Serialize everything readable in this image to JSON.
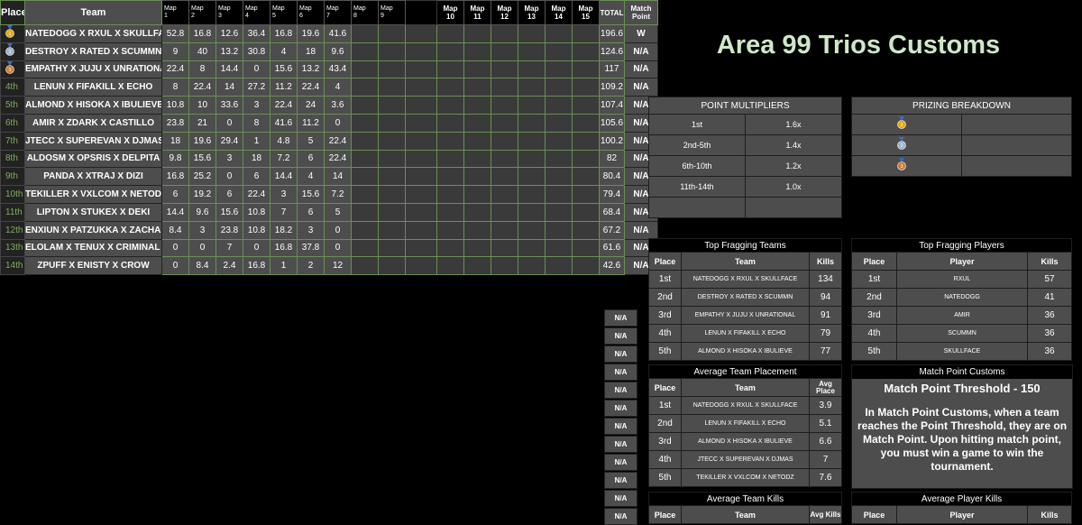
{
  "standings": {
    "headers": {
      "place": "Place",
      "team": "Team",
      "maps_small": [
        "Map 1",
        "Map 2",
        "Map 3",
        "Map 4",
        "Map 5",
        "Map 6",
        "Map 7",
        "Map 8",
        "Map 9"
      ],
      "maps_big": [
        "Map 10",
        "Map 11",
        "Map 12",
        "Map 13",
        "Map 14",
        "Map 15"
      ],
      "total": "TOTAL",
      "match_point": "Match Point"
    },
    "rows": [
      {
        "place": "",
        "medal": "gold",
        "team": "NATEDOGG X RXUL X SKULLFACE",
        "maps": [
          "52.8",
          "16.8",
          "12.6",
          "36.4",
          "16.8",
          "19.6",
          "41.6"
        ],
        "total": "196.6",
        "mp": "W"
      },
      {
        "place": "",
        "medal": "silver",
        "team": "DESTROY X RATED X SCUMMN",
        "maps": [
          "9",
          "40",
          "13.2",
          "30.8",
          "4",
          "18",
          "9.6"
        ],
        "total": "124.6",
        "mp": "N/A"
      },
      {
        "place": "",
        "medal": "bronze",
        "team": "EMPATHY X JUJU X UNRATIONAL",
        "maps": [
          "22.4",
          "8",
          "14.4",
          "0",
          "15.6",
          "13.2",
          "43.4"
        ],
        "total": "117",
        "mp": "N/A"
      },
      {
        "place": "4th",
        "team": "LENUN X FIFAKILL X ECHO",
        "maps": [
          "8",
          "22.4",
          "14",
          "27.2",
          "11.2",
          "22.4",
          "4"
        ],
        "total": "109.2",
        "mp": "N/A"
      },
      {
        "place": "5th",
        "team": "ALMOND X HISOKA X IBULIEVE",
        "maps": [
          "10.8",
          "10",
          "33.6",
          "3",
          "22.4",
          "24",
          "3.6"
        ],
        "total": "107.4",
        "mp": "N/A"
      },
      {
        "place": "6th",
        "team": "AMIR X ZDARK X CASTILLO",
        "maps": [
          "23.8",
          "21",
          "0",
          "8",
          "41.6",
          "11.2",
          "0"
        ],
        "total": "105.6",
        "mp": "N/A"
      },
      {
        "place": "7th",
        "team": "JTECC X SUPEREVAN X DJMAS",
        "maps": [
          "18",
          "19.6",
          "29.4",
          "1",
          "4.8",
          "5",
          "22.4"
        ],
        "total": "100.2",
        "mp": "N/A"
      },
      {
        "place": "8th",
        "team": "ALDOSM X OPSRIS X DELPITA",
        "maps": [
          "9.8",
          "15.6",
          "3",
          "18",
          "7.2",
          "6",
          "22.4"
        ],
        "total": "82",
        "mp": "N/A"
      },
      {
        "place": "9th",
        "team": "PANDA X XTRAJ X DIZI",
        "maps": [
          "16.8",
          "25.2",
          "0",
          "6",
          "14.4",
          "4",
          "14"
        ],
        "total": "80.4",
        "mp": "N/A"
      },
      {
        "place": "10th",
        "team": "TEKILLER X VXLCOM X NETODZ",
        "maps": [
          "6",
          "19.2",
          "6",
          "22.4",
          "3",
          "15.6",
          "7.2"
        ],
        "total": "79.4",
        "mp": "N/A"
      },
      {
        "place": "11th",
        "team": "LIPTON X STUKEX X DEKI",
        "maps": [
          "14.4",
          "9.6",
          "15.6",
          "10.8",
          "7",
          "6",
          "5"
        ],
        "total": "68.4",
        "mp": "N/A"
      },
      {
        "place": "12th",
        "team": "ENXIUN X PATZUKKA X ZACHAR",
        "maps": [
          "8.4",
          "3",
          "23.8",
          "10.8",
          "18.2",
          "3",
          "0"
        ],
        "total": "67.2",
        "mp": "N/A"
      },
      {
        "place": "13th",
        "team": "ELOLAM X TENUX X CRIMINAL GOD",
        "maps": [
          "0",
          "0",
          "7",
          "0",
          "16.8",
          "37.8",
          "0"
        ],
        "total": "61.6",
        "mp": "N/A"
      },
      {
        "place": "14th",
        "team": "ZPUFF X ENISTY X CROW",
        "maps": [
          "0",
          "8.4",
          "2.4",
          "16.8",
          "1",
          "2",
          "12"
        ],
        "total": "42.6",
        "mp": "N/A"
      }
    ],
    "extra_mp": [
      "N/A",
      "N/A",
      "N/A",
      "N/A",
      "N/A",
      "N/A",
      "N/A",
      "N/A",
      "N/A",
      "N/A",
      "N/A",
      "N/A"
    ]
  },
  "title": "Area 99 Trios Customs",
  "multipliers": {
    "header": "POINT MULTIPLIERS",
    "rows": [
      {
        "label": "1st",
        "value": "1.6x"
      },
      {
        "label": "2nd-5th",
        "value": "1.4x"
      },
      {
        "label": "6th-10th",
        "value": "1.2x"
      },
      {
        "label": "11th-14th",
        "value": "1.0x"
      },
      {
        "label": "",
        "value": ""
      }
    ]
  },
  "prizing": {
    "header": "PRIZING BREAKDOWN",
    "rows": [
      {
        "medal": "gold"
      },
      {
        "medal": "silver"
      },
      {
        "medal": "bronze"
      }
    ]
  },
  "top_teams": {
    "header": "Top Fragging Teams",
    "cols": [
      "Place",
      "Team",
      "Kills"
    ],
    "rows": [
      {
        "place": "1st",
        "name": "NATEDOGG X RXUL X SKULLFACE",
        "val": "134"
      },
      {
        "place": "2nd",
        "name": "DESTROY X RATED X SCUMMN",
        "val": "94"
      },
      {
        "place": "3rd",
        "name": "EMPATHY X JUJU X UNRATIONAL",
        "val": "91"
      },
      {
        "place": "4th",
        "name": "LENUN X FIFAKILL X ECHO",
        "val": "79"
      },
      {
        "place": "5th",
        "name": "ALMOND X HISOKA X IBULIEVE",
        "val": "77"
      }
    ]
  },
  "top_players": {
    "header": "Top Fragging Players",
    "cols": [
      "Place",
      "Player",
      "Kills"
    ],
    "rows": [
      {
        "place": "1st",
        "name": "RXUL",
        "val": "57"
      },
      {
        "place": "2nd",
        "name": "NATEDOGG",
        "val": "41"
      },
      {
        "place": "3rd",
        "name": "AMIR",
        "val": "36"
      },
      {
        "place": "4th",
        "name": "SCUMMN",
        "val": "36"
      },
      {
        "place": "5th",
        "name": "SKULLFACE",
        "val": "36"
      }
    ]
  },
  "avg_placement": {
    "header": "Average Team Placement",
    "cols": [
      "Place",
      "Team",
      "Avg Place"
    ],
    "rows": [
      {
        "place": "1st",
        "name": "NATEDOGG X RXUL X SKULLFACE",
        "val": "3.9"
      },
      {
        "place": "2nd",
        "name": "LENUN X FIFAKILL X ECHO",
        "val": "5.1"
      },
      {
        "place": "3rd",
        "name": "ALMOND X HISOKA X IBULIEVE",
        "val": "6.6"
      },
      {
        "place": "4th",
        "name": "JTECC X SUPEREVAN X DJMAS",
        "val": "7"
      },
      {
        "place": "5th",
        "name": "TEKILLER X VXLCOM X NETODZ",
        "val": "7.6"
      }
    ]
  },
  "match_point": {
    "header": "Match Point Customs",
    "threshold": "Match Point Threshold - 150",
    "description": "In Match Point Customs, when a team reaches the Point Threshold, they are on Match Point. Upon hitting match point, you must win a game to win the tournament."
  },
  "avg_team_kills": {
    "header": "Average Team Kills",
    "cols": [
      "Place",
      "Team",
      "Avg Kills"
    ]
  },
  "avg_player_kills": {
    "header": "Average Player Kills",
    "cols": [
      "Place",
      "Player",
      "Kills"
    ]
  },
  "colors": {
    "gold": "#e6a817",
    "silver": "#9fb4c8",
    "bronze": "#c97f3a",
    "place_text": "#7fae5c",
    "title": "#cfe8c7"
  }
}
